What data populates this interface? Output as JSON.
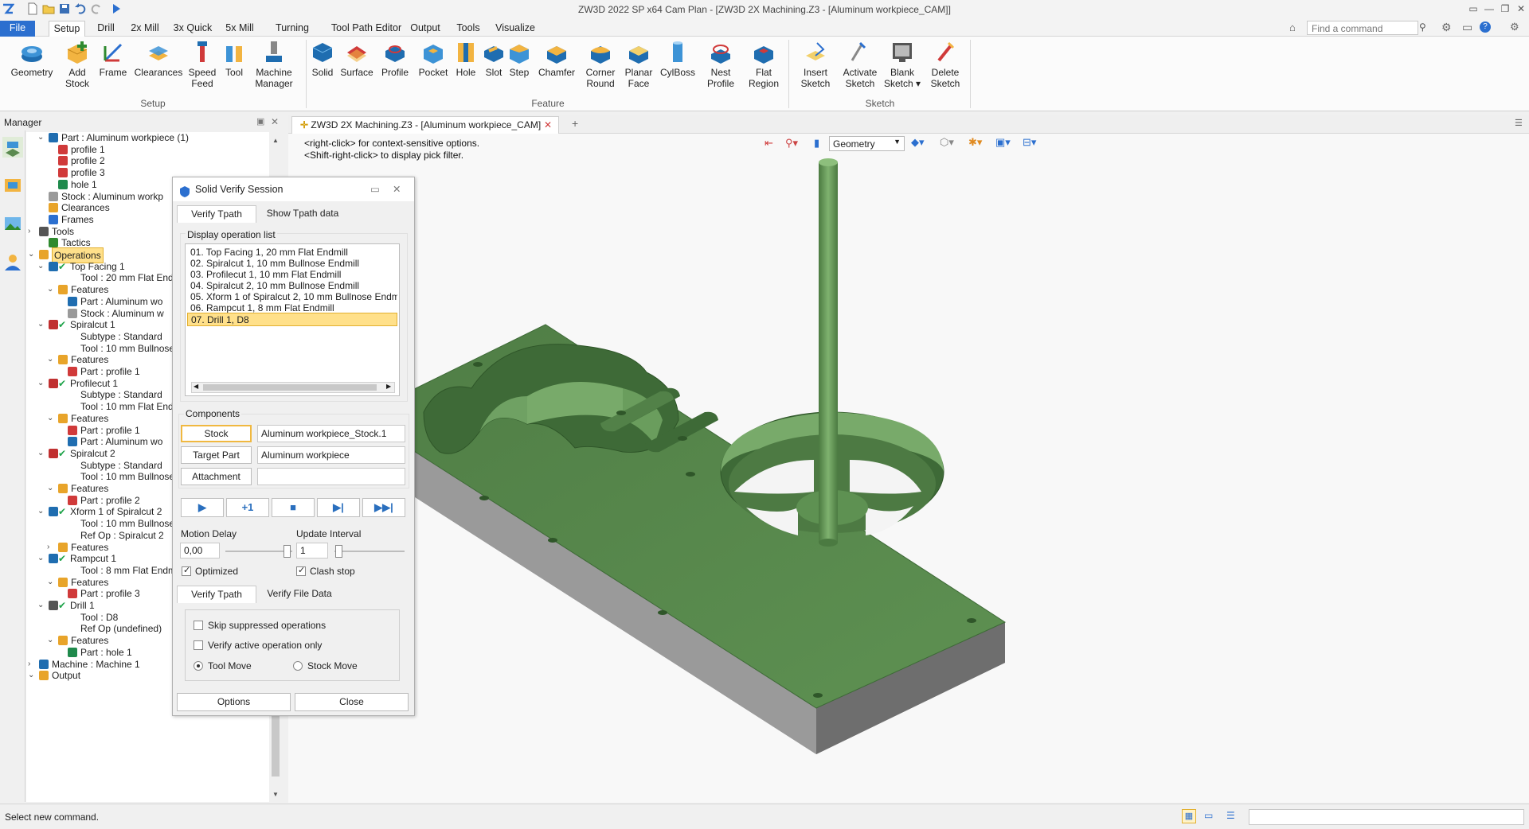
{
  "window": {
    "title": "ZW3D 2022 SP x64      Cam Plan - [ZW3D 2X Machining.Z3 - [Aluminum workpiece_CAM]]"
  },
  "menu": {
    "file": "File",
    "tabs": [
      "Setup",
      "Drill",
      "2x Mill",
      "3x Quick",
      "5x Mill",
      "Turning",
      "Tool Path Editor",
      "Output",
      "Tools",
      "Visualize"
    ],
    "search_placeholder": "Find a command"
  },
  "ribbon": {
    "groups": [
      "Setup",
      "Feature",
      "Sketch"
    ],
    "setup": [
      {
        "label": "Geometry",
        "icon": "geometry-icon"
      },
      {
        "label": "Add\nStock",
        "icon": "add-stock-icon"
      },
      {
        "label": "Frame",
        "icon": "frame-icon"
      },
      {
        "label": "Clearances",
        "icon": "clearances-icon"
      },
      {
        "label": "Speed\nFeed",
        "icon": "speed-feed-icon"
      },
      {
        "label": "Tool",
        "icon": "tool-icon"
      },
      {
        "label": "Machine\nManager",
        "icon": "machine-manager-icon"
      }
    ],
    "feature": [
      {
        "label": "Solid",
        "icon": "solid-icon"
      },
      {
        "label": "Surface",
        "icon": "surface-icon"
      },
      {
        "label": "Profile",
        "icon": "profile-icon"
      },
      {
        "label": "Pocket",
        "icon": "pocket-icon"
      },
      {
        "label": "Hole",
        "icon": "hole-icon"
      },
      {
        "label": "Slot",
        "icon": "slot-icon"
      },
      {
        "label": "Step",
        "icon": "step-icon"
      },
      {
        "label": "Chamfer",
        "icon": "chamfer-icon"
      },
      {
        "label": "Corner\nRound",
        "icon": "corner-round-icon"
      },
      {
        "label": "Planar\nFace",
        "icon": "planar-face-icon"
      },
      {
        "label": "CylBoss",
        "icon": "cylboss-icon"
      },
      {
        "label": "Nest\nProfile",
        "icon": "nest-profile-icon"
      },
      {
        "label": "Flat\nRegion",
        "icon": "flat-region-icon"
      }
    ],
    "sketch": [
      {
        "label": "Insert\nSketch",
        "icon": "insert-sketch-icon"
      },
      {
        "label": "Activate\nSketch",
        "icon": "activate-sketch-icon"
      },
      {
        "label": "Blank\nSketch ▾",
        "icon": "blank-sketch-icon"
      },
      {
        "label": "Delete\nSketch",
        "icon": "delete-sketch-icon"
      }
    ]
  },
  "manager": {
    "title": "Manager",
    "tree": [
      {
        "label": "Part : Aluminum workpiece (1)",
        "lvl": 1,
        "exp": "v",
        "icon": "part-icon"
      },
      {
        "label": "profile 1",
        "lvl": 2,
        "exp": "",
        "icon": "profile-icon"
      },
      {
        "label": "profile 2",
        "lvl": 2,
        "exp": "",
        "icon": "profile-icon"
      },
      {
        "label": "profile 3",
        "lvl": 2,
        "exp": "",
        "icon": "profile-icon"
      },
      {
        "label": "hole 1",
        "lvl": 2,
        "exp": "",
        "icon": "hole-icon"
      },
      {
        "label": "Stock : Aluminum workp",
        "lvl": 1,
        "exp": "",
        "icon": "stock-icon"
      },
      {
        "label": "Clearances",
        "lvl": 1,
        "exp": "",
        "icon": "clearances-icon"
      },
      {
        "label": "Frames",
        "lvl": 1,
        "exp": "",
        "icon": "frame-icon"
      },
      {
        "label": "Tools",
        "lvl": 0,
        "exp": ">",
        "icon": "tools-icon"
      },
      {
        "label": "Tactics",
        "lvl": 1,
        "exp": "",
        "icon": "tactics-icon"
      },
      {
        "label": "Operations",
        "lvl": 0,
        "exp": "v",
        "icon": "operations-icon",
        "hl": true
      },
      {
        "label": "Top Facing 1",
        "lvl": 1,
        "exp": "v",
        "icon": "facing-icon",
        "check": true
      },
      {
        "label": "Tool : 20 mm Flat Endm",
        "lvl": 3,
        "exp": "",
        "icon": ""
      },
      {
        "label": "Features",
        "lvl": 2,
        "exp": "v",
        "icon": "features-icon"
      },
      {
        "label": "Part : Aluminum wo",
        "lvl": 3,
        "exp": "",
        "icon": "part-icon"
      },
      {
        "label": "Stock : Aluminum w",
        "lvl": 3,
        "exp": "",
        "icon": "stock-icon"
      },
      {
        "label": "Spiralcut 1",
        "lvl": 1,
        "exp": "v",
        "icon": "spiralcut-icon",
        "check": true
      },
      {
        "label": "Subtype : Standard",
        "lvl": 3,
        "exp": "",
        "icon": ""
      },
      {
        "label": "Tool : 10 mm Bullnose",
        "lvl": 3,
        "exp": "",
        "icon": ""
      },
      {
        "label": "Features",
        "lvl": 2,
        "exp": "v",
        "icon": "features-icon"
      },
      {
        "label": "Part : profile 1",
        "lvl": 3,
        "exp": "",
        "icon": "profile-icon"
      },
      {
        "label": "Profilecut 1",
        "lvl": 1,
        "exp": "v",
        "icon": "profilecut-icon",
        "check": true
      },
      {
        "label": "Subtype : Standard",
        "lvl": 3,
        "exp": "",
        "icon": ""
      },
      {
        "label": "Tool : 10 mm Flat Endn",
        "lvl": 3,
        "exp": "",
        "icon": ""
      },
      {
        "label": "Features",
        "lvl": 2,
        "exp": "v",
        "icon": "features-icon"
      },
      {
        "label": "Part : profile 1",
        "lvl": 3,
        "exp": "",
        "icon": "profile-icon"
      },
      {
        "label": "Part : Aluminum wo",
        "lvl": 3,
        "exp": "",
        "icon": "part-icon"
      },
      {
        "label": "Spiralcut 2",
        "lvl": 1,
        "exp": "v",
        "icon": "spiralcut-icon",
        "check": true
      },
      {
        "label": "Subtype : Standard",
        "lvl": 3,
        "exp": "",
        "icon": ""
      },
      {
        "label": "Tool : 10 mm Bullnose",
        "lvl": 3,
        "exp": "",
        "icon": ""
      },
      {
        "label": "Features",
        "lvl": 2,
        "exp": "v",
        "icon": "features-icon"
      },
      {
        "label": "Part : profile 2",
        "lvl": 3,
        "exp": "",
        "icon": "profile-icon"
      },
      {
        "label": "Xform 1 of Spiralcut 2",
        "lvl": 1,
        "exp": "v",
        "icon": "xform-icon",
        "check": true
      },
      {
        "label": "Tool : 10 mm Bullnose",
        "lvl": 3,
        "exp": "",
        "icon": ""
      },
      {
        "label": "Ref Op : Spiralcut 2",
        "lvl": 3,
        "exp": "",
        "icon": ""
      },
      {
        "label": "Features",
        "lvl": 2,
        "exp": ">",
        "icon": "features-icon"
      },
      {
        "label": "Rampcut 1",
        "lvl": 1,
        "exp": "v",
        "icon": "rampcut-icon",
        "check": true
      },
      {
        "label": "Tool : 8 mm Flat Endm",
        "lvl": 3,
        "exp": "",
        "icon": ""
      },
      {
        "label": "Features",
        "lvl": 2,
        "exp": "v",
        "icon": "features-icon"
      },
      {
        "label": "Part : profile 3",
        "lvl": 3,
        "exp": "",
        "icon": "profile-icon"
      },
      {
        "label": "Drill 1",
        "lvl": 1,
        "exp": "v",
        "icon": "drill-icon",
        "check": true
      },
      {
        "label": "Tool : D8",
        "lvl": 3,
        "exp": "",
        "icon": ""
      },
      {
        "label": "Ref Op (undefined)",
        "lvl": 3,
        "exp": "",
        "icon": ""
      },
      {
        "label": "Features",
        "lvl": 2,
        "exp": "v",
        "icon": "features-icon"
      },
      {
        "label": "Part : hole 1",
        "lvl": 3,
        "exp": "",
        "icon": "hole-icon"
      },
      {
        "label": "Machine : Machine 1",
        "lvl": 0,
        "exp": ">",
        "icon": "machine-icon"
      },
      {
        "label": "Output",
        "lvl": 0,
        "exp": "v",
        "icon": "output-icon"
      }
    ]
  },
  "document_tab": "ZW3D 2X Machining.Z3 - [Aluminum workpiece_CAM]",
  "viewport": {
    "hint1": "<right-click> for context-sensitive options.",
    "hint2": "<Shift-right-click> to display pick filter.",
    "filter_value": "Geometry",
    "model_color": "#5b8a50"
  },
  "dialog": {
    "title": "Solid Verify Session",
    "tabs_top": [
      "Verify Tpath",
      "Show Tpath data"
    ],
    "oplist_title": "Display operation list",
    "operations": [
      "01. Top Facing 1, 20 mm Flat Endmill",
      "02. Spiralcut 1, 10 mm Bullnose Endmill",
      "03. Profilecut 1, 10 mm Flat Endmill",
      "04. Spiralcut 2, 10 mm Bullnose Endmill",
      "05. Xform 1 of Spiralcut 2, 10 mm Bullnose Endmill",
      "06. Rampcut 1, 8 mm Flat Endmill",
      "07. Drill 1, D8"
    ],
    "components_title": "Components",
    "stock_btn": "Stock",
    "stock_val": "Aluminum workpiece_Stock.1",
    "target_btn": "Target Part",
    "target_val": "Aluminum workpiece",
    "attach_btn": "Attachment",
    "attach_val": "",
    "step_label": "+1",
    "motion_delay_label": "Motion Delay",
    "motion_delay_val": "0,00",
    "update_interval_label": "Update Interval",
    "update_interval_val": "1",
    "optimized_label": "Optimized",
    "clash_label": "Clash stop",
    "tabs_bottom": [
      "Verify Tpath",
      "Verify File Data"
    ],
    "skip_label": "Skip suppressed operations",
    "active_only_label": "Verify active operation only",
    "tool_move_label": "Tool Move",
    "stock_move_label": "Stock Move",
    "options_btn": "Options",
    "close_btn": "Close"
  },
  "status": {
    "text": "Select new command."
  }
}
